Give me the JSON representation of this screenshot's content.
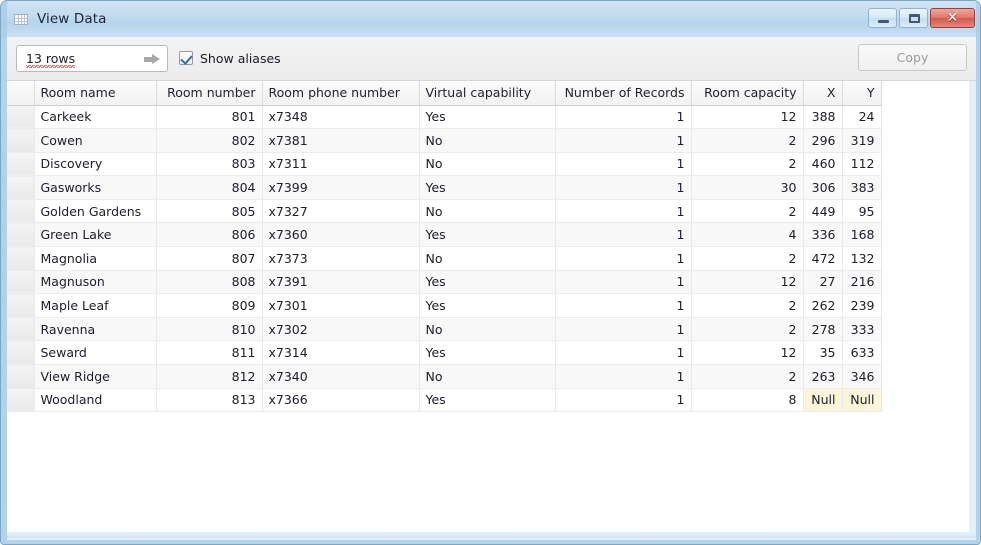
{
  "window": {
    "title": "View Data",
    "icon": "table-grid-icon",
    "controls": {
      "minimize": "minimize-icon",
      "maximize": "maximize-icon",
      "close": "✕"
    }
  },
  "toolbar": {
    "rows_value": "13 rows",
    "rows_placeholder": "rows",
    "go_arrow": "arrow-right-icon",
    "show_aliases_label": "Show aliases",
    "show_aliases_checked": true,
    "copy_label": "Copy",
    "copy_enabled": false
  },
  "grid": {
    "columns": [
      {
        "label": "Room name",
        "align": "left",
        "cls": "c-name"
      },
      {
        "label": "Room number",
        "align": "right",
        "cls": "c-num"
      },
      {
        "label": "Room phone number",
        "align": "left",
        "cls": "c-phone"
      },
      {
        "label": "Virtual capability",
        "align": "left",
        "cls": "c-virt"
      },
      {
        "label": "Number of Records",
        "align": "right",
        "cls": "c-rec"
      },
      {
        "label": "Room capacity",
        "align": "right",
        "cls": "c-cap"
      },
      {
        "label": "X",
        "align": "right",
        "cls": "c-x"
      },
      {
        "label": "Y",
        "align": "right",
        "cls": "c-y"
      }
    ],
    "rows": [
      {
        "name": "Carkeek",
        "number": "801",
        "phone": "x7348",
        "virtual": "Yes",
        "records": "1",
        "capacity": "12",
        "x": "388",
        "y": "24",
        "null_xy": false
      },
      {
        "name": "Cowen",
        "number": "802",
        "phone": "x7381",
        "virtual": "No",
        "records": "1",
        "capacity": "2",
        "x": "296",
        "y": "319",
        "null_xy": false
      },
      {
        "name": "Discovery",
        "number": "803",
        "phone": "x7311",
        "virtual": "No",
        "records": "1",
        "capacity": "2",
        "x": "460",
        "y": "112",
        "null_xy": false
      },
      {
        "name": "Gasworks",
        "number": "804",
        "phone": "x7399",
        "virtual": "Yes",
        "records": "1",
        "capacity": "30",
        "x": "306",
        "y": "383",
        "null_xy": false
      },
      {
        "name": "Golden Gardens",
        "number": "805",
        "phone": "x7327",
        "virtual": "No",
        "records": "1",
        "capacity": "2",
        "x": "449",
        "y": "95",
        "null_xy": false
      },
      {
        "name": "Green Lake",
        "number": "806",
        "phone": "x7360",
        "virtual": "Yes",
        "records": "1",
        "capacity": "4",
        "x": "336",
        "y": "168",
        "null_xy": false
      },
      {
        "name": "Magnolia",
        "number": "807",
        "phone": "x7373",
        "virtual": "No",
        "records": "1",
        "capacity": "2",
        "x": "472",
        "y": "132",
        "null_xy": false
      },
      {
        "name": "Magnuson",
        "number": "808",
        "phone": "x7391",
        "virtual": "Yes",
        "records": "1",
        "capacity": "12",
        "x": "27",
        "y": "216",
        "null_xy": false
      },
      {
        "name": "Maple Leaf",
        "number": "809",
        "phone": "x7301",
        "virtual": "Yes",
        "records": "1",
        "capacity": "2",
        "x": "262",
        "y": "239",
        "null_xy": false
      },
      {
        "name": "Ravenna",
        "number": "810",
        "phone": "x7302",
        "virtual": "No",
        "records": "1",
        "capacity": "2",
        "x": "278",
        "y": "333",
        "null_xy": false
      },
      {
        "name": "Seward",
        "number": "811",
        "phone": "x7314",
        "virtual": "Yes",
        "records": "1",
        "capacity": "12",
        "x": "35",
        "y": "633",
        "null_xy": false
      },
      {
        "name": "View Ridge",
        "number": "812",
        "phone": "x7340",
        "virtual": "No",
        "records": "1",
        "capacity": "2",
        "x": "263",
        "y": "346",
        "null_xy": false
      },
      {
        "name": "Woodland",
        "number": "813",
        "phone": "x7366",
        "virtual": "Yes",
        "records": "1",
        "capacity": "8",
        "x": "Null",
        "y": "Null",
        "null_xy": true
      }
    ]
  },
  "colors": {
    "null_cell_bg": "#fbf6d9",
    "titlebar": "#c3dcf0",
    "close_button": "#d2594b",
    "frame_border": "#a8cee7"
  }
}
